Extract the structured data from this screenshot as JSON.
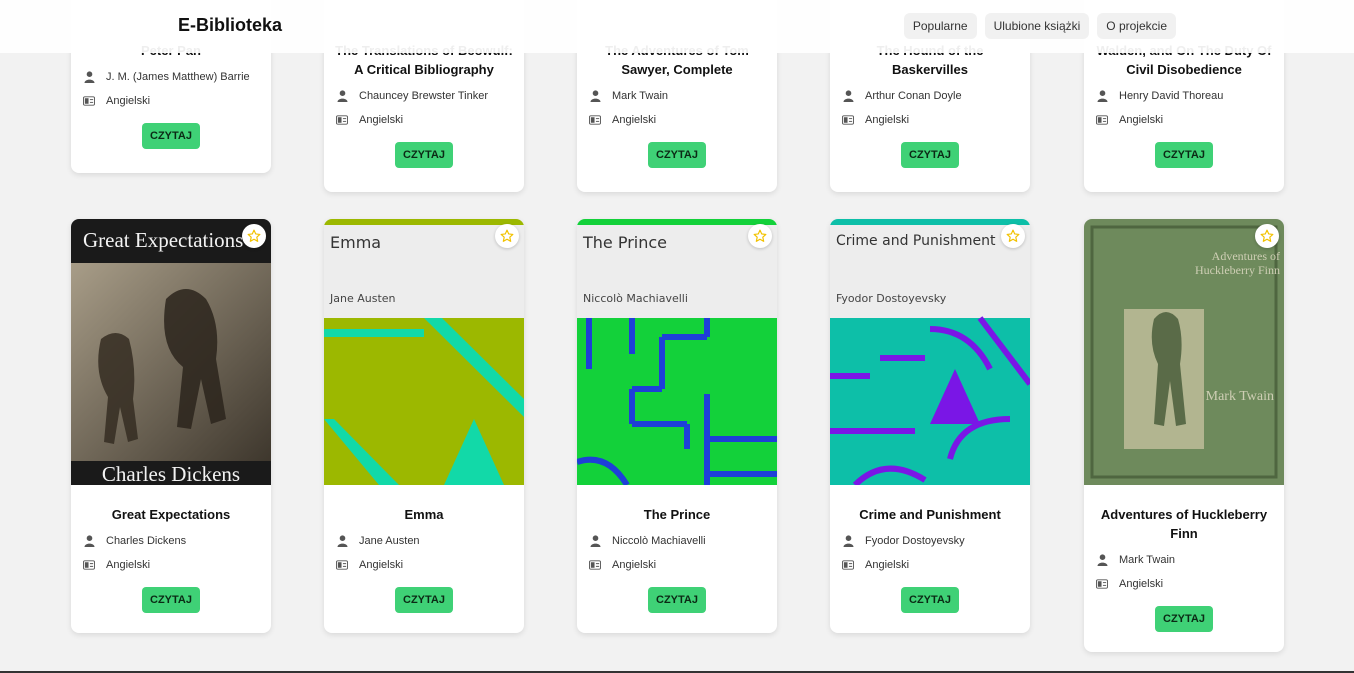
{
  "header": {
    "brand": "E-Biblioteka",
    "nav": [
      "Popularne",
      "Ulubione książki",
      "O projekcie"
    ]
  },
  "read_label": "CZYTAJ",
  "language_label": "Angielski",
  "row1": [
    {
      "title": "Peter Pan",
      "author": "J. M. (James Matthew) Barrie"
    },
    {
      "title": "The Translations of Beowulf: A Critical Bibliography",
      "author": "Chauncey Brewster Tinker"
    },
    {
      "title": "The Adventures of Tom Sawyer, Complete",
      "author": "Mark Twain"
    },
    {
      "title": "The Hound of the Baskervilles",
      "author": "Arthur Conan Doyle"
    },
    {
      "title": "Walden, and On The Duty Of Civil Disobedience",
      "author": "Henry David Thoreau"
    }
  ],
  "row2": [
    {
      "title": "Great Expectations",
      "author": "Charles Dickens",
      "cover_title": "Great Expectations",
      "cover_author": "Charles Dickens"
    },
    {
      "title": "Emma",
      "author": "Jane Austen",
      "cover_title": "Emma",
      "cover_author": "Jane Austen"
    },
    {
      "title": "The Prince",
      "author": "Niccolò Machiavelli",
      "cover_title": "The Prince",
      "cover_author": "Niccolò Machiavelli"
    },
    {
      "title": "Crime and Punishment",
      "author": "Fyodor Dostoyevsky",
      "cover_title": "Crime and Punishment",
      "cover_author": "Fyodor Dostoyevsky"
    },
    {
      "title": "Adventures of Huckleberry Finn",
      "author": "Mark Twain",
      "cover_title": "Adventures of Huckleberry Finn",
      "cover_author": "Mark Twain"
    }
  ],
  "colors": {
    "accent_button": "#3fd176",
    "favorite_star": "#f2c200",
    "emma_cover": "#9cb800",
    "emma_pattern": "#12d9a8",
    "prince_cover": "#13d13a",
    "prince_pattern": "#1e3fd8",
    "crime_cover": "#0dbfa8",
    "crime_pattern": "#7a16e6",
    "huck_cover": "#6e8a5c"
  },
  "icons": {
    "author": "person-icon",
    "language": "language-icon",
    "favorite": "star-icon"
  }
}
